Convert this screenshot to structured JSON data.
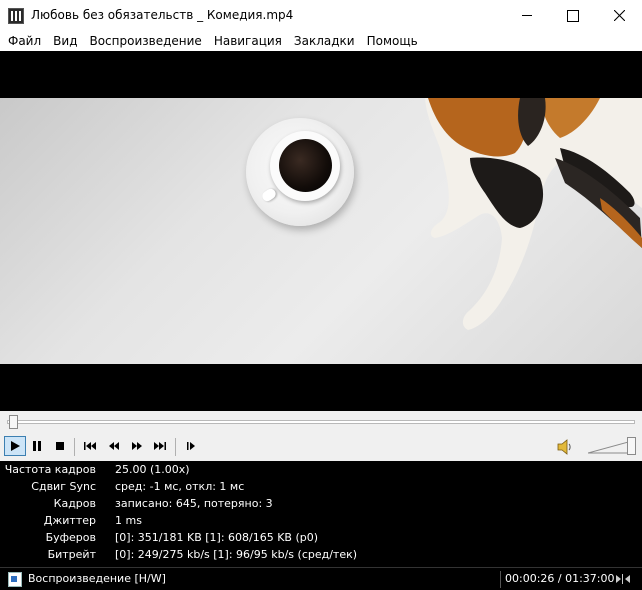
{
  "window": {
    "title": "Любовь без обязательств _ Комедия.mp4"
  },
  "menu": [
    {
      "label": "Файл"
    },
    {
      "label": "Вид"
    },
    {
      "label": "Воспроизведение"
    },
    {
      "label": "Навигация"
    },
    {
      "label": "Закладки"
    },
    {
      "label": "Помощь"
    }
  ],
  "playback": {
    "progress": 0.004,
    "volume": 1.0,
    "state": "playing"
  },
  "stats": [
    {
      "label": "Частота кадров",
      "value": "25.00 (1.00x)"
    },
    {
      "label": "Сдвиг Sync",
      "value": "сред: -1 мс, откл: 1 мс"
    },
    {
      "label": "Кадров",
      "value": "записано: 645, потеряно: 3"
    },
    {
      "label": "Джиттер",
      "value": "1 ms"
    },
    {
      "label": "Буферов",
      "value": "[0]: 351/181 KB [1]: 608/165 KB (p0)"
    },
    {
      "label": "Битрейт",
      "value": "[0]: 249/275 kb/s [1]: 96/95 kb/s (сред/тек)"
    }
  ],
  "status": {
    "text": "Воспроизведение [H/W]",
    "time": "00:00:26 / 01:37:00"
  },
  "icons": {
    "app": "media-player-icon",
    "play": "play-icon",
    "pause": "pause-icon",
    "stop": "stop-icon",
    "prev": "skip-back-icon",
    "rewind": "rewind-icon",
    "forward": "fast-forward-icon",
    "next": "skip-forward-icon",
    "frame_step": "frame-step-icon",
    "volume": "speaker-icon"
  },
  "colors": {
    "accent": "#3c7fb1",
    "active_bg": "#cce4f7",
    "stats_bg": "#000000",
    "stats_text": "#ffffff"
  }
}
